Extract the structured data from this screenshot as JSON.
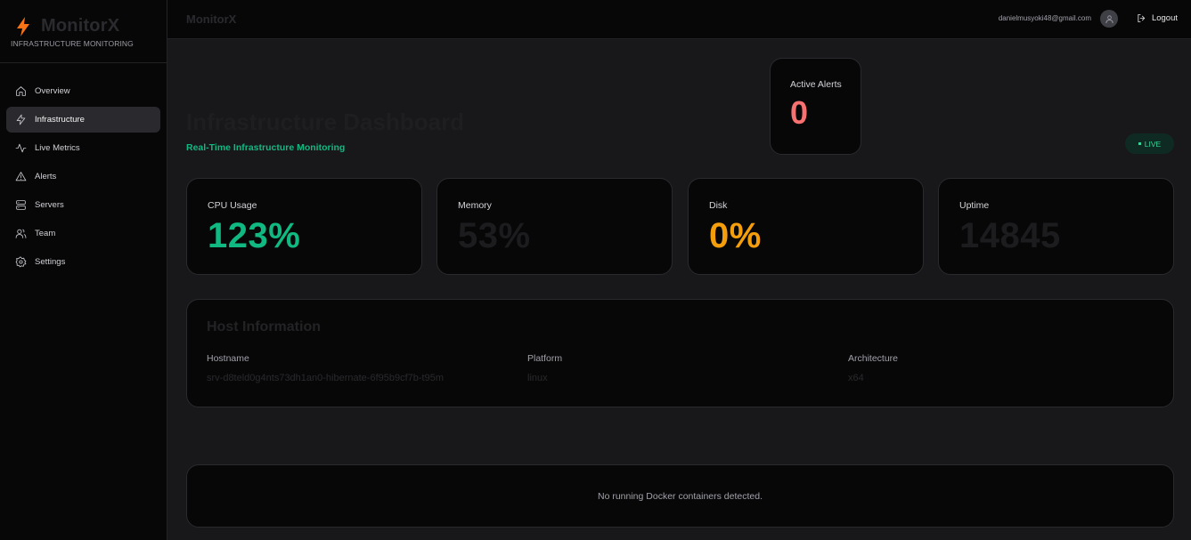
{
  "brand": {
    "name": "MonitorX",
    "subtitle": "INFRASTRUCTURE MONITORING",
    "accent": "#f97316"
  },
  "sidebar": {
    "items": [
      {
        "label": "Overview",
        "icon": "home-icon"
      },
      {
        "label": "Infrastructure",
        "icon": "bolt-icon",
        "active": true
      },
      {
        "label": "Live Metrics",
        "icon": "activity-icon"
      },
      {
        "label": "Alerts",
        "icon": "warning-icon"
      },
      {
        "label": "Servers",
        "icon": "server-icon"
      },
      {
        "label": "Team",
        "icon": "users-icon"
      },
      {
        "label": "Settings",
        "icon": "gear-icon"
      }
    ]
  },
  "topbar": {
    "title": "MonitorX",
    "email": "danielmusyoki48@gmail.com",
    "logout_label": "Logout"
  },
  "page": {
    "title": "Infrastructure Dashboard",
    "subtitle": "Real-Time Infrastructure Monitoring",
    "live_label": "LIVE"
  },
  "alerts": {
    "label": "Active Alerts",
    "value": "0",
    "color": "#f87171"
  },
  "stats": [
    {
      "label": "CPU Usage",
      "value": "123%",
      "color": "#10b981"
    },
    {
      "label": "Memory",
      "value": "53%",
      "color": "#1c1c1f"
    },
    {
      "label": "Disk",
      "value": "0%",
      "color": "#f59e0b"
    },
    {
      "label": "Uptime",
      "value": "14845",
      "color": "#1c1c1f"
    }
  ],
  "host": {
    "title": "Host Information",
    "fields": [
      {
        "label": "Hostname",
        "value": "srv-d8teld0g4nts73dh1an0-hibernate-6f95b9cf7b-t95m"
      },
      {
        "label": "Platform",
        "value": "linux"
      },
      {
        "label": "Architecture",
        "value": "x64"
      }
    ]
  },
  "docker": {
    "message": "No running Docker containers detected."
  }
}
